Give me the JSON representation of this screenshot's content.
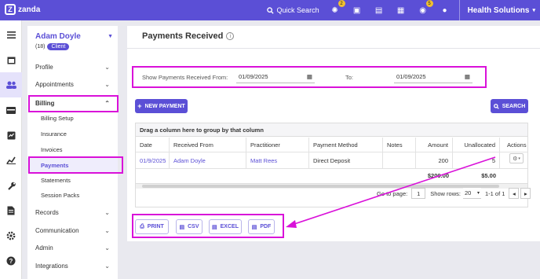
{
  "app": {
    "name": "zanda",
    "quick_search": "Quick Search",
    "org_name": "Health Solutions",
    "badge_notifications": "2",
    "badge_tasks": "5"
  },
  "icons": {
    "topbar": [
      "activity-icon",
      "image-icon",
      "clipboard-icon",
      "calendar-plus-icon",
      "chat-icon"
    ],
    "iconbar": [
      "menu-icon",
      "calendar-icon",
      "users-icon",
      "wallet-icon",
      "file-invoice-icon",
      "chart-icon",
      "wrench-icon",
      "document-icon",
      "settings-icon",
      "help-icon"
    ]
  },
  "client": {
    "name": "Adam Doyle",
    "count": "(18)",
    "badge": "Client"
  },
  "sidebar": {
    "items": [
      {
        "label": "Profile"
      },
      {
        "label": "Appointments"
      },
      {
        "label": "Billing"
      },
      {
        "label": "Records"
      },
      {
        "label": "Communication"
      },
      {
        "label": "Admin"
      },
      {
        "label": "Integrations"
      }
    ],
    "billing_sub": [
      {
        "label": "Billing Setup"
      },
      {
        "label": "Insurance"
      },
      {
        "label": "Invoices"
      },
      {
        "label": "Payments"
      },
      {
        "label": "Statements"
      },
      {
        "label": "Session Packs"
      }
    ]
  },
  "page": {
    "title": "Payments Received"
  },
  "filter": {
    "from_label": "Show Payments Received From:",
    "from_value": "01/09/2025",
    "to_label": "To:",
    "to_value": "01/09/2025"
  },
  "buttons": {
    "new_payment": "NEW PAYMENT",
    "search": "SEARCH"
  },
  "grid": {
    "group_text": "Drag a column here to group by that column",
    "columns": [
      "Date",
      "Received From",
      "Practitioner",
      "Payment Method",
      "Notes",
      "Amount",
      "Unallocated",
      "Actions"
    ],
    "rows": [
      {
        "date": "01/9/2025",
        "received_from": "Adam Doyle",
        "practitioner": "Matt Rees",
        "payment_method": "Direct Deposit",
        "notes": "",
        "amount": "200",
        "unallocated": "5"
      }
    ],
    "totals": {
      "amount": "$200.00",
      "unallocated": "$5.00"
    }
  },
  "pager": {
    "goto_label": "Go to page:",
    "page": "1",
    "show_rows_label": "Show rows:",
    "rows_per_page": "20",
    "range": "1-1 of 1"
  },
  "export": {
    "print": "PRINT",
    "csv": "CSV",
    "excel": "EXCEL",
    "pdf": "PDF"
  },
  "colors": {
    "accent": "#5b4fd6",
    "annotation": "#d911d9"
  }
}
